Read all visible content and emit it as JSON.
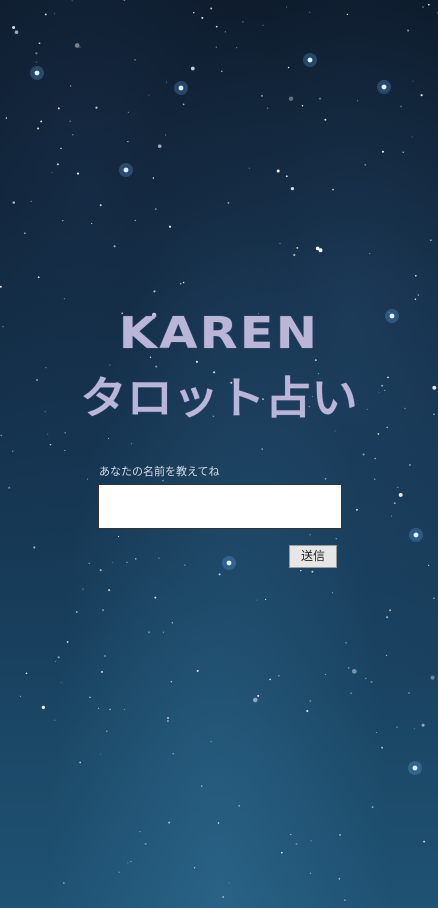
{
  "background": {
    "theme": "starry-night-sky",
    "color_top": "#0d1a2a",
    "color_bottom": "#1f5273",
    "star_color": "#ffffff",
    "glow_star_color": "#6fb4ff"
  },
  "header": {
    "title_line1": "KAREN",
    "title_line2": "タロット占い",
    "title_color": "#b9b6d8"
  },
  "form": {
    "name_label": "あなたの名前を教えてね",
    "name_value": "",
    "name_placeholder": "",
    "submit_label": "送信"
  }
}
